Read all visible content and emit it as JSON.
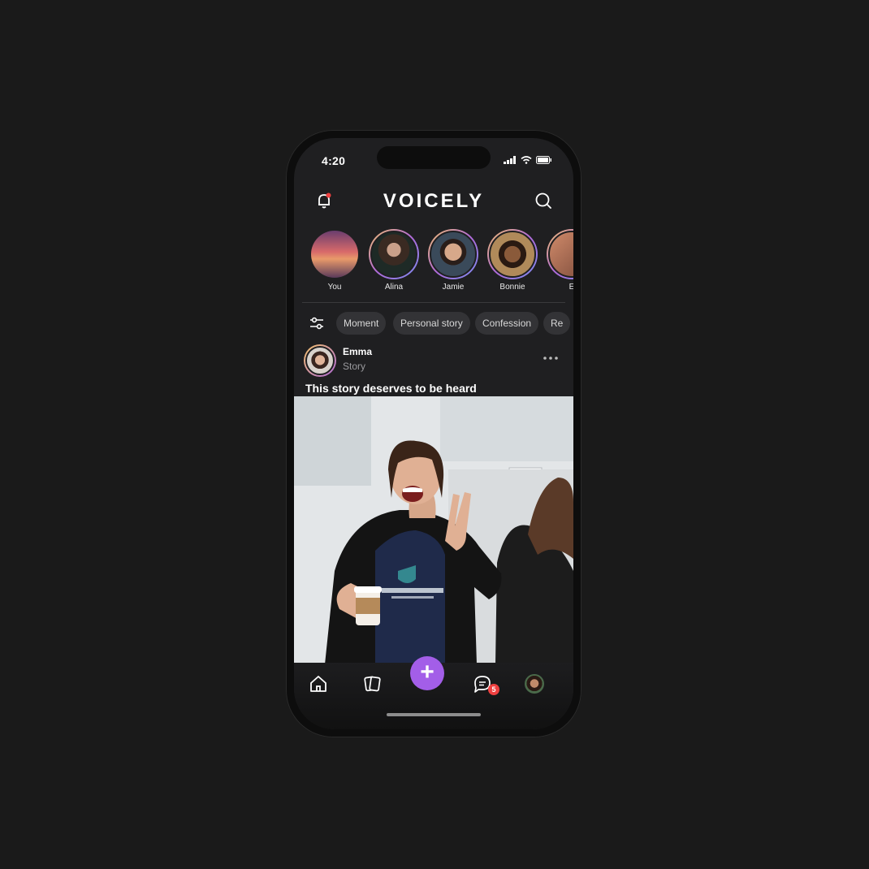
{
  "status_bar": {
    "time": "4:20"
  },
  "header": {
    "logo": "VOICELY"
  },
  "stories": [
    {
      "name": "You"
    },
    {
      "name": "Alina"
    },
    {
      "name": "Jamie"
    },
    {
      "name": "Bonnie"
    },
    {
      "name": "E"
    }
  ],
  "filters": [
    "Moment",
    "Personal story",
    "Confession",
    "Re"
  ],
  "post": {
    "author": "Emma",
    "type": "Story",
    "title": "This story deserves to be heard"
  },
  "tabbar": {
    "fab_label": "+",
    "messages_badge": "5"
  },
  "colors": {
    "accent": "#a35ee8",
    "badge": "#ef4040",
    "background": "#1f1f21"
  }
}
